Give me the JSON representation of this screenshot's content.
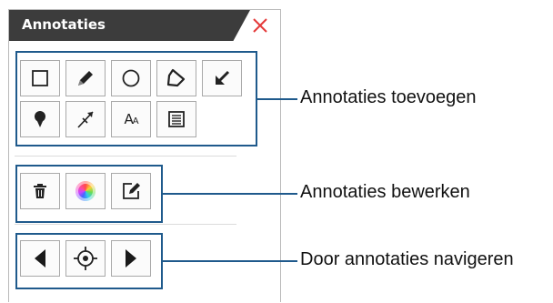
{
  "panel": {
    "title": "Annotaties",
    "close_icon": "close-icon",
    "accent_color": "#1f5a8c",
    "close_color": "#e43a3a"
  },
  "groups": [
    {
      "label": "Annotaties toevoegen",
      "tools": [
        {
          "name": "rectangle-tool",
          "icon": "square-icon"
        },
        {
          "name": "pen-tool",
          "icon": "pencil-icon"
        },
        {
          "name": "circle-tool",
          "icon": "circle-icon"
        },
        {
          "name": "polygon-tool",
          "icon": "polygon-icon"
        },
        {
          "name": "arrow-tool",
          "icon": "arrow-down-left-icon"
        },
        {
          "name": "pin-tool",
          "icon": "map-pin-icon"
        },
        {
          "name": "measure-tool",
          "icon": "ruler-pen-icon"
        },
        {
          "name": "text-tool",
          "icon": "text-size-icon",
          "text_big": "A",
          "text_small": "A"
        },
        {
          "name": "note-tool",
          "icon": "note-icon"
        }
      ]
    },
    {
      "label": "Annotaties bewerken",
      "tools": [
        {
          "name": "delete-tool",
          "icon": "trash-icon"
        },
        {
          "name": "color-tool",
          "icon": "color-wheel-icon"
        },
        {
          "name": "edit-tool",
          "icon": "edit-note-icon"
        }
      ]
    },
    {
      "label": "Door annotaties navigeren",
      "tools": [
        {
          "name": "previous-button",
          "icon": "triangle-left-icon"
        },
        {
          "name": "center-button",
          "icon": "crosshair-icon"
        },
        {
          "name": "next-button",
          "icon": "triangle-right-icon"
        }
      ]
    }
  ]
}
